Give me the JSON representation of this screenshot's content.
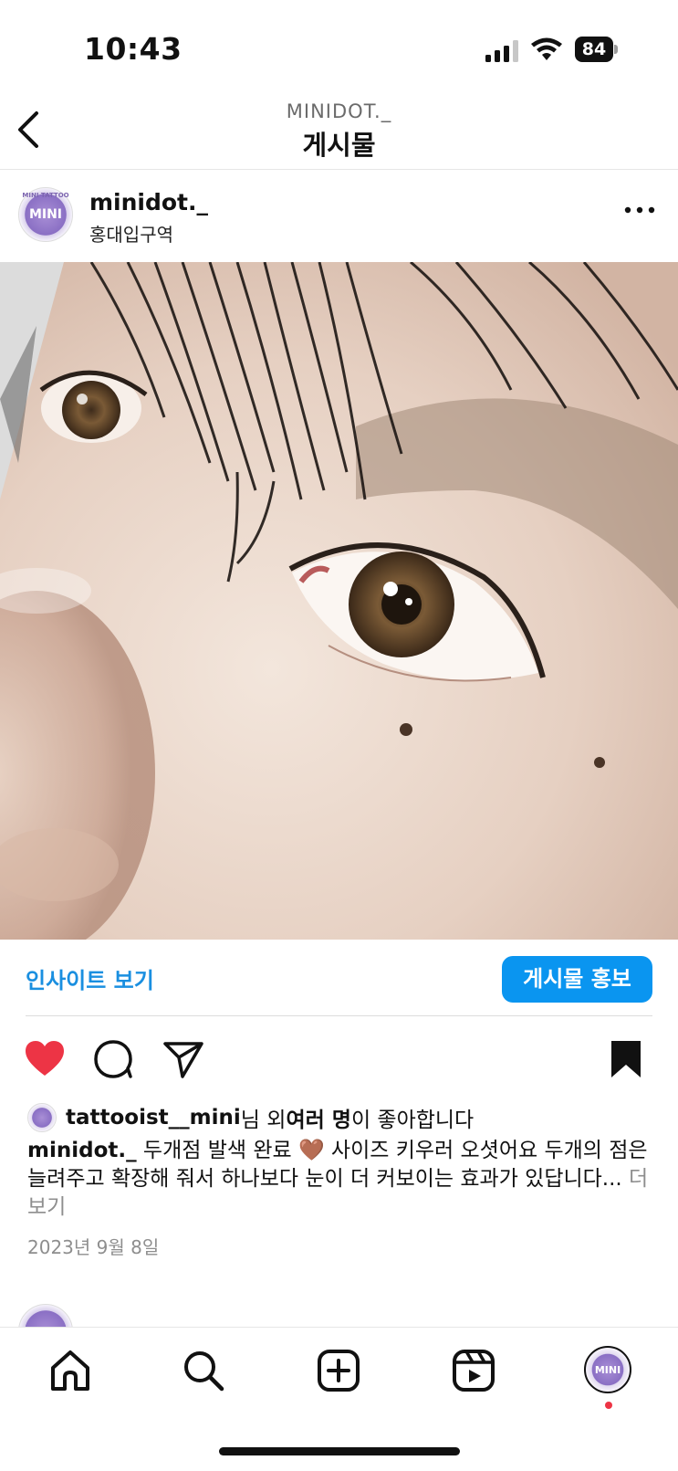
{
  "status_bar": {
    "time": "10:43",
    "battery": "84"
  },
  "header": {
    "account": "MINIDOT._",
    "title": "게시물"
  },
  "post": {
    "username": "minidot._",
    "location": "홍대입구역",
    "avatar_text": "MINI",
    "avatar_ring_text": "MINI TATTOO",
    "insight_label": "인사이트 보기",
    "promote_label": "게시물 홍보",
    "liked": true,
    "saved": true,
    "likes": {
      "user": "tattooist__mini",
      "text_1": "님 외 ",
      "many": "여러 명",
      "text_2": "이 좋아합니다"
    },
    "caption": {
      "user": "minidot._",
      "text": " 두개점 발색 완료 🤎 사이즈 키우러 오셧어요  두개의 점은 늘려주고 확장해 줘서 하나보다 눈이 더 커보이는 효과가 있답니다...",
      "more": " 더 보기"
    },
    "date": "2023년 9월 8일"
  },
  "colors": {
    "accent": "#0a95f0",
    "insight_text": "#1a8fe0",
    "heart": "#ed3445",
    "muted": "#8e8e8e"
  },
  "icons": {
    "back": "chevron-left-icon",
    "more": "more-dots-icon",
    "like": "heart-icon",
    "comment": "comment-icon",
    "share": "paper-plane-icon",
    "save": "bookmark-icon",
    "tabs": [
      "home-icon",
      "search-icon",
      "create-icon",
      "reels-icon",
      "profile-avatar"
    ]
  }
}
